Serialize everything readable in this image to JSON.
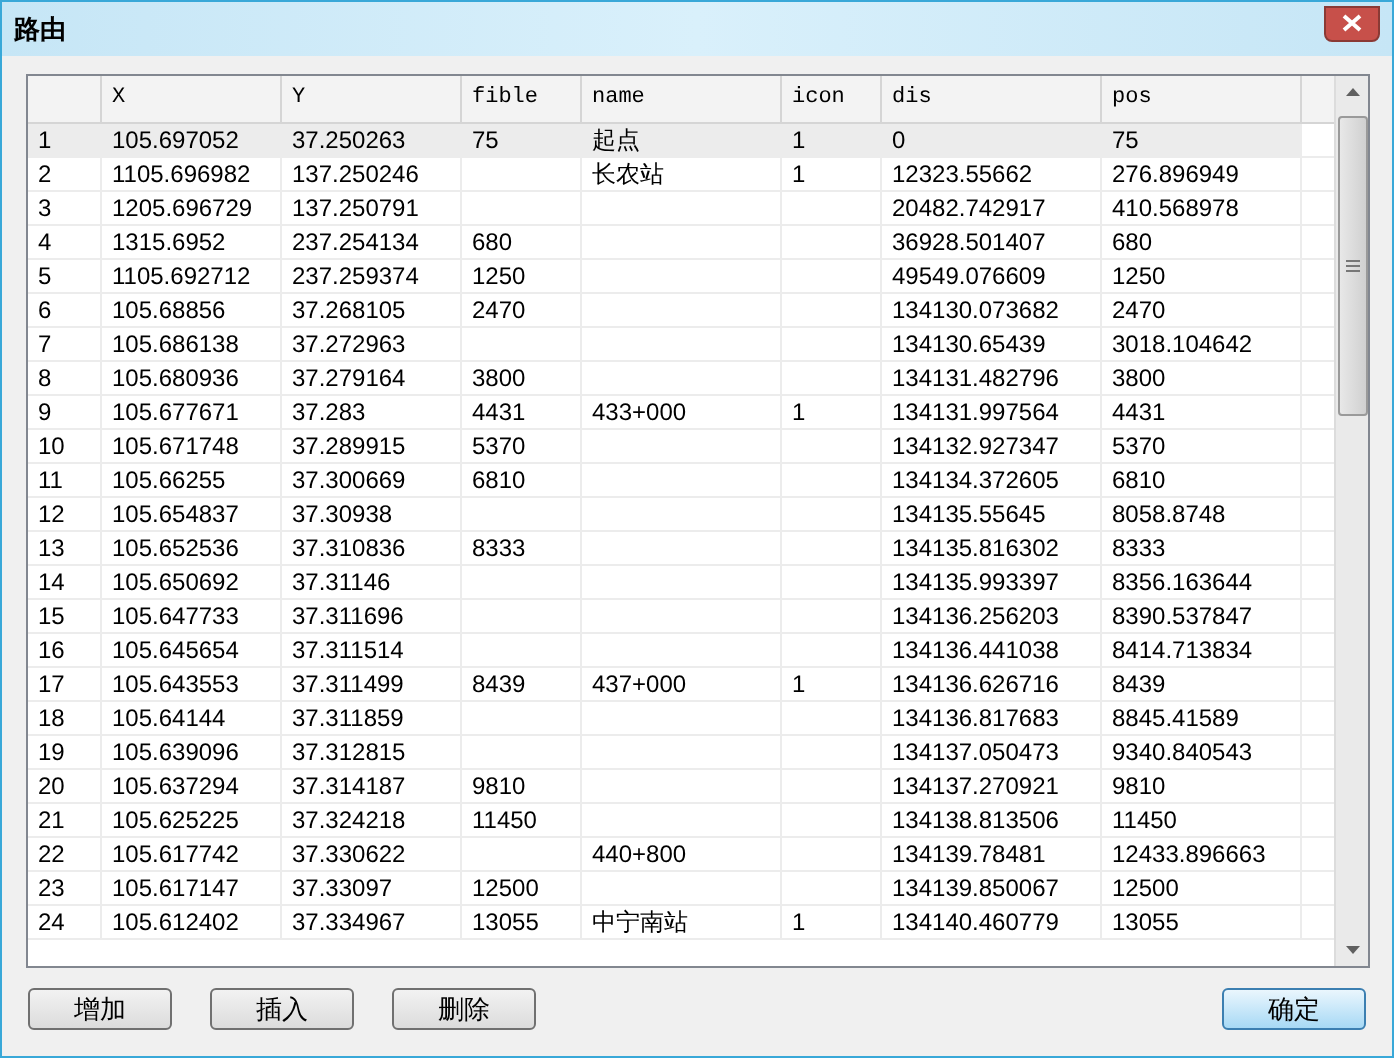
{
  "window": {
    "title": "路由"
  },
  "table": {
    "columns": [
      "",
      "X",
      "Y",
      "fible",
      "name",
      "icon",
      "dis",
      "pos"
    ],
    "rows": [
      {
        "selected": true,
        "cells": [
          "1",
          "105.697052",
          "37.250263",
          "75",
          "起点",
          "1",
          "0",
          "75"
        ]
      },
      {
        "selected": false,
        "cells": [
          "2",
          "1105.696982",
          "137.250246",
          null,
          "长农站",
          "1",
          "12323.55662",
          "276.896949"
        ]
      },
      {
        "selected": false,
        "cells": [
          "3",
          "1205.696729",
          "137.250791",
          null,
          null,
          null,
          "20482.742917",
          "410.568978"
        ]
      },
      {
        "selected": false,
        "cells": [
          "4",
          "1315.6952",
          "237.254134",
          "680",
          null,
          null,
          "36928.501407",
          "680"
        ]
      },
      {
        "selected": false,
        "cells": [
          "5",
          "1105.692712",
          "237.259374",
          "1250",
          null,
          null,
          "49549.076609",
          "1250"
        ]
      },
      {
        "selected": false,
        "cells": [
          "6",
          "105.68856",
          "37.268105",
          "2470",
          null,
          null,
          "134130.073682",
          "2470"
        ]
      },
      {
        "selected": false,
        "cells": [
          "7",
          "105.686138",
          "37.272963",
          null,
          null,
          null,
          "134130.65439",
          "3018.104642"
        ]
      },
      {
        "selected": false,
        "cells": [
          "8",
          "105.680936",
          "37.279164",
          "3800",
          null,
          null,
          "134131.482796",
          "3800"
        ]
      },
      {
        "selected": false,
        "cells": [
          "9",
          "105.677671",
          "37.283",
          "4431",
          "433+000",
          "1",
          "134131.997564",
          "4431"
        ]
      },
      {
        "selected": false,
        "cells": [
          "10",
          "105.671748",
          "37.289915",
          "5370",
          null,
          null,
          "134132.927347",
          "5370"
        ]
      },
      {
        "selected": false,
        "cells": [
          "11",
          "105.66255",
          "37.300669",
          "6810",
          null,
          null,
          "134134.372605",
          "6810"
        ]
      },
      {
        "selected": false,
        "cells": [
          "12",
          "105.654837",
          "37.30938",
          null,
          null,
          null,
          "134135.55645",
          "8058.8748"
        ]
      },
      {
        "selected": false,
        "cells": [
          "13",
          "105.652536",
          "37.310836",
          "8333",
          null,
          null,
          "134135.816302",
          "8333"
        ]
      },
      {
        "selected": false,
        "cells": [
          "14",
          "105.650692",
          "37.31146",
          null,
          null,
          null,
          "134135.993397",
          "8356.163644"
        ]
      },
      {
        "selected": false,
        "cells": [
          "15",
          "105.647733",
          "37.311696",
          null,
          null,
          null,
          "134136.256203",
          "8390.537847"
        ]
      },
      {
        "selected": false,
        "cells": [
          "16",
          "105.645654",
          "37.311514",
          null,
          null,
          null,
          "134136.441038",
          "8414.713834"
        ]
      },
      {
        "selected": false,
        "cells": [
          "17",
          "105.643553",
          "37.311499",
          "8439",
          "437+000",
          "1",
          "134136.626716",
          "8439"
        ]
      },
      {
        "selected": false,
        "cells": [
          "18",
          "105.64144",
          "37.311859",
          null,
          null,
          null,
          "134136.817683",
          "8845.41589"
        ]
      },
      {
        "selected": false,
        "cells": [
          "19",
          "105.639096",
          "37.312815",
          null,
          null,
          null,
          "134137.050473",
          "9340.840543"
        ]
      },
      {
        "selected": false,
        "cells": [
          "20",
          "105.637294",
          "37.314187",
          "9810",
          null,
          null,
          "134137.270921",
          "9810"
        ]
      },
      {
        "selected": false,
        "cells": [
          "21",
          "105.625225",
          "37.324218",
          "11450",
          null,
          null,
          "134138.813506",
          "11450"
        ]
      },
      {
        "selected": false,
        "cells": [
          "22",
          "105.617742",
          "37.330622",
          null,
          "440+800",
          null,
          "134139.78481",
          "12433.896663"
        ]
      },
      {
        "selected": false,
        "cells": [
          "23",
          "105.617147",
          "37.33097",
          "12500",
          null,
          null,
          "134139.850067",
          "12500"
        ]
      },
      {
        "selected": false,
        "cells": [
          "24",
          "105.612402",
          "37.334967",
          "13055",
          "中宁南站",
          "1",
          "134140.460779",
          "13055"
        ]
      }
    ]
  },
  "buttons": [
    {
      "label": "增加",
      "default": false
    },
    {
      "label": "插入",
      "default": false
    },
    {
      "label": "删除",
      "default": false
    },
    {
      "label": "确定",
      "default": true
    }
  ]
}
